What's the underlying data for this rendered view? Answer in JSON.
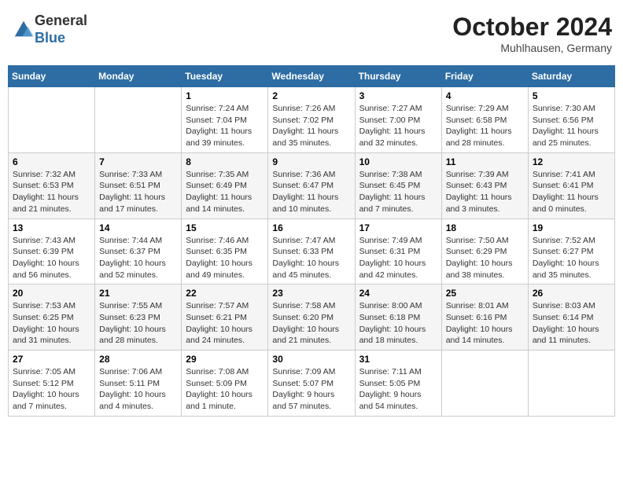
{
  "header": {
    "logo": {
      "line1": "General",
      "line2": "Blue"
    },
    "month": "October 2024",
    "location": "Muhlhausen, Germany"
  },
  "weekdays": [
    "Sunday",
    "Monday",
    "Tuesday",
    "Wednesday",
    "Thursday",
    "Friday",
    "Saturday"
  ],
  "weeks": [
    [
      {
        "day": "",
        "info": ""
      },
      {
        "day": "",
        "info": ""
      },
      {
        "day": "1",
        "info": "Sunrise: 7:24 AM\nSunset: 7:04 PM\nDaylight: 11 hours and 39 minutes."
      },
      {
        "day": "2",
        "info": "Sunrise: 7:26 AM\nSunset: 7:02 PM\nDaylight: 11 hours and 35 minutes."
      },
      {
        "day": "3",
        "info": "Sunrise: 7:27 AM\nSunset: 7:00 PM\nDaylight: 11 hours and 32 minutes."
      },
      {
        "day": "4",
        "info": "Sunrise: 7:29 AM\nSunset: 6:58 PM\nDaylight: 11 hours and 28 minutes."
      },
      {
        "day": "5",
        "info": "Sunrise: 7:30 AM\nSunset: 6:56 PM\nDaylight: 11 hours and 25 minutes."
      }
    ],
    [
      {
        "day": "6",
        "info": "Sunrise: 7:32 AM\nSunset: 6:53 PM\nDaylight: 11 hours and 21 minutes."
      },
      {
        "day": "7",
        "info": "Sunrise: 7:33 AM\nSunset: 6:51 PM\nDaylight: 11 hours and 17 minutes."
      },
      {
        "day": "8",
        "info": "Sunrise: 7:35 AM\nSunset: 6:49 PM\nDaylight: 11 hours and 14 minutes."
      },
      {
        "day": "9",
        "info": "Sunrise: 7:36 AM\nSunset: 6:47 PM\nDaylight: 11 hours and 10 minutes."
      },
      {
        "day": "10",
        "info": "Sunrise: 7:38 AM\nSunset: 6:45 PM\nDaylight: 11 hours and 7 minutes."
      },
      {
        "day": "11",
        "info": "Sunrise: 7:39 AM\nSunset: 6:43 PM\nDaylight: 11 hours and 3 minutes."
      },
      {
        "day": "12",
        "info": "Sunrise: 7:41 AM\nSunset: 6:41 PM\nDaylight: 11 hours and 0 minutes."
      }
    ],
    [
      {
        "day": "13",
        "info": "Sunrise: 7:43 AM\nSunset: 6:39 PM\nDaylight: 10 hours and 56 minutes."
      },
      {
        "day": "14",
        "info": "Sunrise: 7:44 AM\nSunset: 6:37 PM\nDaylight: 10 hours and 52 minutes."
      },
      {
        "day": "15",
        "info": "Sunrise: 7:46 AM\nSunset: 6:35 PM\nDaylight: 10 hours and 49 minutes."
      },
      {
        "day": "16",
        "info": "Sunrise: 7:47 AM\nSunset: 6:33 PM\nDaylight: 10 hours and 45 minutes."
      },
      {
        "day": "17",
        "info": "Sunrise: 7:49 AM\nSunset: 6:31 PM\nDaylight: 10 hours and 42 minutes."
      },
      {
        "day": "18",
        "info": "Sunrise: 7:50 AM\nSunset: 6:29 PM\nDaylight: 10 hours and 38 minutes."
      },
      {
        "day": "19",
        "info": "Sunrise: 7:52 AM\nSunset: 6:27 PM\nDaylight: 10 hours and 35 minutes."
      }
    ],
    [
      {
        "day": "20",
        "info": "Sunrise: 7:53 AM\nSunset: 6:25 PM\nDaylight: 10 hours and 31 minutes."
      },
      {
        "day": "21",
        "info": "Sunrise: 7:55 AM\nSunset: 6:23 PM\nDaylight: 10 hours and 28 minutes."
      },
      {
        "day": "22",
        "info": "Sunrise: 7:57 AM\nSunset: 6:21 PM\nDaylight: 10 hours and 24 minutes."
      },
      {
        "day": "23",
        "info": "Sunrise: 7:58 AM\nSunset: 6:20 PM\nDaylight: 10 hours and 21 minutes."
      },
      {
        "day": "24",
        "info": "Sunrise: 8:00 AM\nSunset: 6:18 PM\nDaylight: 10 hours and 18 minutes."
      },
      {
        "day": "25",
        "info": "Sunrise: 8:01 AM\nSunset: 6:16 PM\nDaylight: 10 hours and 14 minutes."
      },
      {
        "day": "26",
        "info": "Sunrise: 8:03 AM\nSunset: 6:14 PM\nDaylight: 10 hours and 11 minutes."
      }
    ],
    [
      {
        "day": "27",
        "info": "Sunrise: 7:05 AM\nSunset: 5:12 PM\nDaylight: 10 hours and 7 minutes."
      },
      {
        "day": "28",
        "info": "Sunrise: 7:06 AM\nSunset: 5:11 PM\nDaylight: 10 hours and 4 minutes."
      },
      {
        "day": "29",
        "info": "Sunrise: 7:08 AM\nSunset: 5:09 PM\nDaylight: 10 hours and 1 minute."
      },
      {
        "day": "30",
        "info": "Sunrise: 7:09 AM\nSunset: 5:07 PM\nDaylight: 9 hours and 57 minutes."
      },
      {
        "day": "31",
        "info": "Sunrise: 7:11 AM\nSunset: 5:05 PM\nDaylight: 9 hours and 54 minutes."
      },
      {
        "day": "",
        "info": ""
      },
      {
        "day": "",
        "info": ""
      }
    ]
  ]
}
